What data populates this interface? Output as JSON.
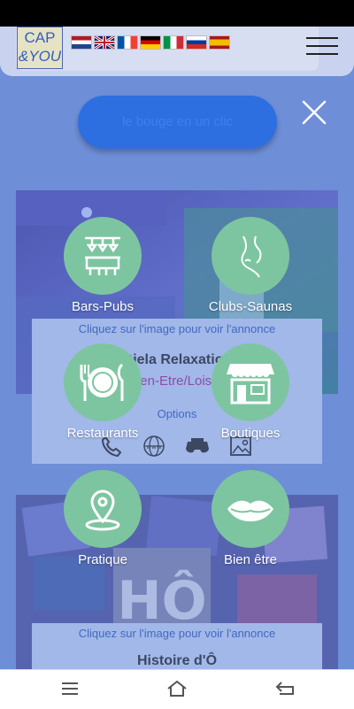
{
  "header": {
    "logo_line1": "CAP",
    "logo_line2": "&YOU",
    "flags": [
      "netherlands-flag",
      "uk-flag",
      "france-flag",
      "germany-flag",
      "italy-flag",
      "russia-flag",
      "spain-flag"
    ]
  },
  "overlay": {
    "cta_label": "le bouge en un clic"
  },
  "categories": [
    {
      "label": "Bars-Pubs",
      "icon": "bar-icon"
    },
    {
      "label": "Clubs-Saunas",
      "icon": "body-silhouette-icon"
    },
    {
      "label": "Restaurants",
      "icon": "plate-cutlery-icon"
    },
    {
      "label": "Boutiques",
      "icon": "shop-icon"
    },
    {
      "label": "Pratique",
      "icon": "map-pin-icon"
    },
    {
      "label": "Bien être",
      "icon": "lips-icon"
    }
  ],
  "cards": [
    {
      "hint": "Cliquez sur l'image pour voir l'annonce",
      "title": "Giela Relaxation",
      "subtitle": "Bien-Etre/Loisirs",
      "options_label": "Options",
      "option_icons": [
        "phone-icon",
        "website-icon",
        "vr-headset-icon",
        "gallery-icon"
      ]
    },
    {
      "hint": "Cliquez sur l'image pour voir l'annonce",
      "title": "Histoire d'Ô"
    }
  ],
  "colors": {
    "background": "#6f8fd8",
    "category_circle": "#7dc5a0",
    "cta_button": "#2d6fe0",
    "hint_text": "#2b57b6",
    "subtitle_text": "#9c2b93"
  }
}
